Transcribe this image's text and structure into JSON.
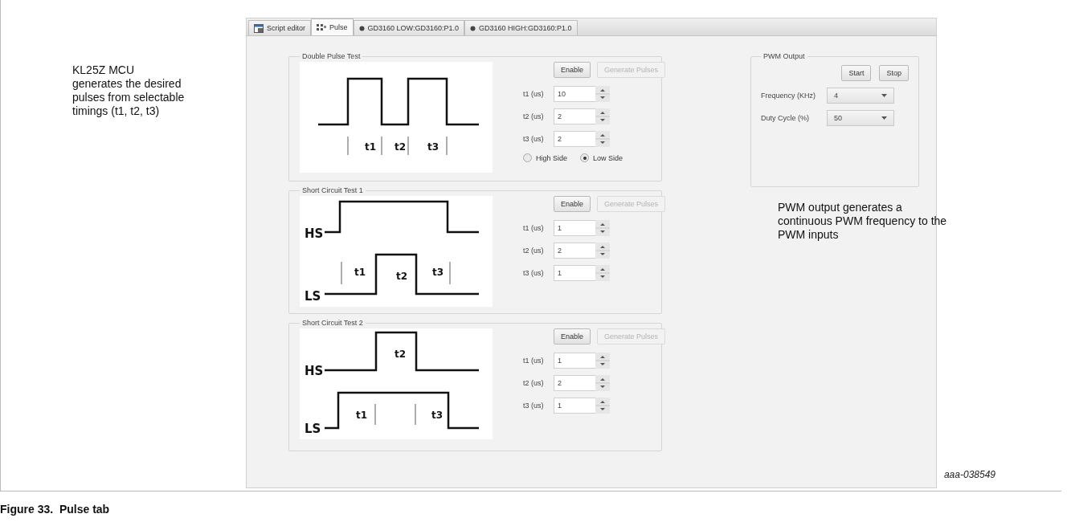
{
  "left_note": [
    "KL25Z MCU",
    "generates the desired",
    "pulses from selectable",
    "timings (t1, t2, t3)"
  ],
  "tabs": [
    {
      "label": "Script editor",
      "selected": false
    },
    {
      "label": "Pulse",
      "selected": true
    },
    {
      "label": "GD3160 LOW:GD3160:P1.0",
      "selected": false
    },
    {
      "label": "GD3160 HIGH:GD3160:P1.0",
      "selected": false
    }
  ],
  "pulse_tests": [
    {
      "title": "Double Pulse Test",
      "diagram": {
        "kind": "double",
        "labels": [
          "t1",
          "t2",
          "t3"
        ]
      },
      "buttons": [
        {
          "label": "Enable",
          "disabled": false
        },
        {
          "label": "Generate Pulses",
          "disabled": true
        }
      ],
      "params": [
        {
          "label": "t1 (us)",
          "value": "10"
        },
        {
          "label": "t2 (us)",
          "value": "2"
        },
        {
          "label": "t3 (us)",
          "value": "2"
        }
      ],
      "radios": [
        {
          "label": "High Side",
          "selected": false
        },
        {
          "label": "Low Side",
          "selected": true
        }
      ]
    },
    {
      "title": "Short Circuit Test 1",
      "diagram": {
        "kind": "sc1",
        "hs": "HS",
        "ls": "LS",
        "labels": [
          "t1",
          "t2",
          "t3"
        ]
      },
      "buttons": [
        {
          "label": "Enable",
          "disabled": false
        },
        {
          "label": "Generate Pulses",
          "disabled": true
        }
      ],
      "params": [
        {
          "label": "t1 (us)",
          "value": "1"
        },
        {
          "label": "t2 (us)",
          "value": "2"
        },
        {
          "label": "t3 (us)",
          "value": "1"
        }
      ]
    },
    {
      "title": "Short Circuit Test 2",
      "diagram": {
        "kind": "sc2",
        "hs": "HS",
        "ls": "LS",
        "labels": [
          "t1",
          "t2",
          "t3"
        ]
      },
      "buttons": [
        {
          "label": "Enable",
          "disabled": false
        },
        {
          "label": "Generate Pulses",
          "disabled": true
        }
      ],
      "params": [
        {
          "label": "t1 (us)",
          "value": "1"
        },
        {
          "label": "t2 (us)",
          "value": "2"
        },
        {
          "label": "t3 (us)",
          "value": "1"
        }
      ]
    }
  ],
  "pwm_output": {
    "title": "PWM Output",
    "buttons": [
      "Start",
      "Stop"
    ],
    "fields": [
      {
        "label": "Frequency (KHz)",
        "value": "4"
      },
      {
        "label": "Duty Cycle (%)",
        "value": "50"
      }
    ]
  },
  "right_note": [
    "PWM output generates a",
    "continuous PWM frequency to the",
    "PWM inputs"
  ],
  "figure_id": "aaa-038549",
  "caption": "Figure 33.  Pulse tab"
}
